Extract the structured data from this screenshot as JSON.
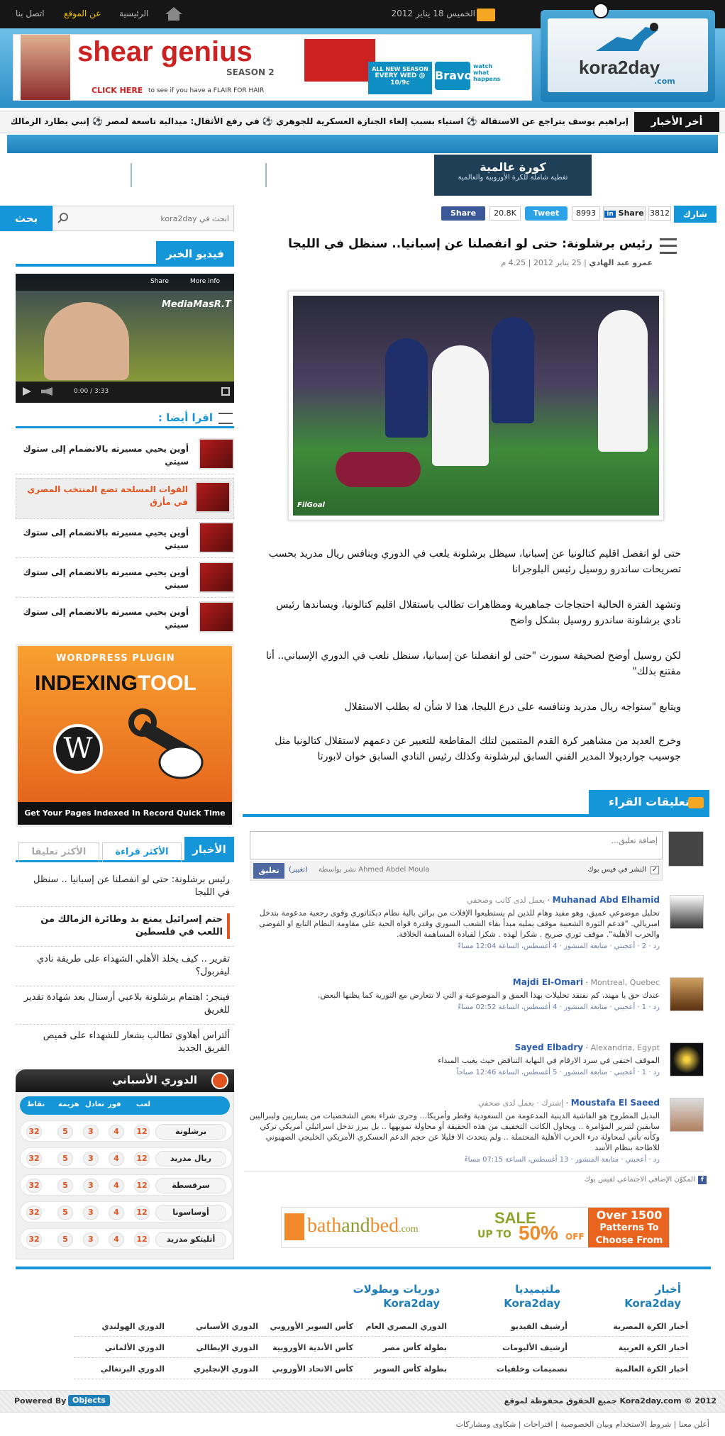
{
  "topbar": {
    "date": "الخميس 18 يناير 2012",
    "home": "الرئيسية",
    "about": "عن الموقع",
    "contact": "اتصل بنا"
  },
  "logo": {
    "name": "kora2day",
    "domain": ".com"
  },
  "banner": {
    "title": "shear genius",
    "season": "SEASON 2",
    "cta": "CLICK HERE",
    "cta_rest": "to see if you have a FLAIR FOR HAIR",
    "promo_line1": "ALL NEW SEASON",
    "promo_line2": "EVERY WED @ 10/9c",
    "brand": "Bravo",
    "slogan": "watch what happens"
  },
  "ticker": {
    "label": "أخر الأخبار",
    "items": [
      "إبراهيم يوسف يتراجع عن الاستقالة",
      "استياء بسبب إلغاء الجنازة العسكرية للجوهري",
      "في رفع الأثقال: ميدالية تاسعة لمصر",
      "إنبي يطارد الزمالك في"
    ]
  },
  "world": {
    "title": "كورة عالمية",
    "subtitle": "تغطية شاملة للكرة الأوروبية والعالمية"
  },
  "search": {
    "placeholder": "ابحث في kora2day",
    "button": "بحث"
  },
  "share": {
    "label": "شارك",
    "linkedin_count": "3812",
    "linkedin": "Share",
    "tweet_count": "8993",
    "tweet": "Tweet",
    "fb_count": "20.8K",
    "fb": "Share"
  },
  "video": {
    "title": "فيديو الخبر",
    "watermark": "MediaMasR.T",
    "share": "Share",
    "more": "More info",
    "time": "0:00 / 3:33"
  },
  "read_also": {
    "title": "اقرا أيضا :",
    "items": [
      "أوين يحيي مسيرته بالانضمام إلى ستوك سيتي",
      "القوات المسلحة تضع المنتخب المصري في مأزق",
      "أوين يحيي مسيرته بالانضمام إلى ستوك سيتي",
      "أوين يحيي مسيرته بالانضمام إلى ستوك سيتي",
      "أوين يحيي مسيرته بالانضمام إلى ستوك سيتي"
    ]
  },
  "ad_plugin": {
    "line1": "WORDPRESS PLUGIN",
    "line2a": "INDEXING",
    "line2b": "TOOL",
    "footer": "Get Your Pages Indexed In Record Quick Time"
  },
  "news_tabs": {
    "tabs": [
      "الأخبار",
      "الأكثر قراءة",
      "الأكثر تعليقا"
    ],
    "items": [
      "رئيس برشلونة: حتى لو انفصلنا عن إسبانيا .. سنظل في الليجا",
      "حتم إسرائيل يمنع بد وطائرة الزمالك من اللعب في فلسطين",
      "تقرير .. كيف يخلد الأهلي الشهداء على طريقة نادي ليفربول؟",
      "فينجر: اهتمام برشلونة بلاعبي أرسنال بعد شهادة تقدير للغريق",
      "ألتراس أهلاوي تطالب بشعار للشهداء على قميص الفريق الجديد"
    ]
  },
  "league": {
    "title": "الدوري الأسباني",
    "headers": [
      "لعب",
      "فوز",
      "تعادل",
      "هزيمة",
      "نقاط"
    ],
    "rows": [
      {
        "team": "برشلونة",
        "vals": [
          "12",
          "4",
          "3",
          "5",
          "32"
        ]
      },
      {
        "team": "ريال مدريد",
        "vals": [
          "12",
          "4",
          "3",
          "5",
          "32"
        ]
      },
      {
        "team": "سرقسطة",
        "vals": [
          "12",
          "4",
          "3",
          "5",
          "32"
        ]
      },
      {
        "team": "أوساسونا",
        "vals": [
          "12",
          "4",
          "3",
          "5",
          "32"
        ]
      },
      {
        "team": "أتليتكو مدريد",
        "vals": [
          "12",
          "4",
          "3",
          "5",
          "32"
        ]
      }
    ]
  },
  "article": {
    "title": "رئيس برشلونة: حتى لو انفصلنا عن إسبانيا.. سنظل في الليجا",
    "author": "عمرو عبد الهادي",
    "date": "25 يناير 2012",
    "time": "4.25 م",
    "photo_credit": "FilGoal",
    "paragraphs": [
      "حتى لو انفصل اقليم كتالونيا عن إسبانيا، سيظل برشلونة يلعب في الدوري وينافس ريال مدريد بحسب تصريحات ساندرو روسيل رئيس البلوجرانا",
      "وتشهد الفترة الحالية احتجاجات جماهيرية ومظاهرات تطالب باستقلال اقليم كتالونيا، ويساندها رئيس نادي برشلونة ساندرو روسيل بشكل واضح",
      "لكن روسيل أوضح لصحيفة سبورت \"حتى لو انفصلنا عن إسبانيا، سنظل نلعب في الدوري الإسباني.. أنا مقتنع بذلك\"",
      "ويتابع \"سنواجه ريال مدريد وننافسه على درع الليجا، هذا لا شأن له بطلب الاستقلال",
      "وخرج العديد من مشاهير كرة القدم المتنمين لتلك المقاطعة للتعبير عن دعمهم لاستقلال كتالونيا مثل جوسيب جوارديولا المدير الفني السابق لبرشلونة وكذلك رئيس النادي السابق خوان لابورتا"
    ]
  },
  "comments": {
    "title": "تعليقات القراء",
    "placeholder": "إضافة تعليق...",
    "fb_post": "النشر في فيس بوك",
    "posting_as": "نشر بواسطة Ahmed Abdel Moula",
    "change": "(تغيير)",
    "submit": "تعليق",
    "plugin": "المكوّن الإضافي الاجتماعي لفيس بوك",
    "items": [
      {
        "name": "Muhanad Abd Elhamid",
        "meta": "يعمل لدى كاتب وصحفي",
        "text": "تحليل موضوعي عميق، وهو مفيد وهام للذين لم يستطيعوا الإفلات من براثن بالية نظام ديكتاتوري وقوى رجعية مدعومة بتدخل امبريالي. \"فدعم الثورة الشعبية موقف يمليه مبدأ بقاء الشعب السوري وقدرة قواه الحية على مقاومة النظام التابع او الفوضى والحرب الأهلية\". موقف ثوري صريح . شكرا لهذه . شكرا لقيادة المساهمة الخلاقة.",
        "footer": "رد · 2 · أعجبني · متابعة المنشور · 4 أغسطس، الساعة 12:04 مساءً"
      },
      {
        "name": "Majdi El-Omari",
        "meta": "Montreal, Quebec",
        "text": "عندك حق يا مهند، كم نفتقد تحليلات بهذا العمق و الموضوعية و التي لا تتعارض مع الثورية كما يظنها البعض.",
        "footer": "رد · 1 · أعجبني · متابعة المنشور · 4 أغسطس، الساعة 02:52 مساءً"
      },
      {
        "name": "Sayed Elbadry",
        "meta": "Alexandria, Egypt",
        "text": "الموقف اختفى في سرد الارقام في النهاية التناقض حيث يغيب المبداء",
        "footer": "رد · 1 · أعجبني · متابعة المنشور · 5 أغسطس، الساعة 12:46 صباحاً"
      },
      {
        "name": "Moustafa El Saeed",
        "meta": "إشترك · يعمل لدى صحفي",
        "text": "البديل المطروح هو الفاشية الدينية المدعومة من السعودية وقطر وأمريكا... وجرى شراء بعض الشخصيات من يساريين وليبراليين سابقين لتبرير المؤامرة .. ويحاول الكاتب التخفيف من هذه الحقيقة أو محاولة تمويهها .. بل يبرز تدخل اسرائيلي أمريكي تركي وكأنه بأتي لمحاولة درء الحرب الأهلية المحتملة .. ولم يتحدث الا قليلا عن حجم الدعم العسكري الأمريكي الخليجي الصهيوني للاطاحة بنظام الأسد",
        "footer": "رد · أعجبني · متابعة المنشور · 13 أغسطس، الساعة 07:15 مساءً"
      }
    ]
  },
  "ad_bath": {
    "brand": "bath",
    "brand2": "and",
    "brand3": "bed",
    "tld": ".com",
    "sale": "SALE",
    "upto": "UP TO",
    "pct": "50%",
    "off": "OFF",
    "right1": "Over 1500",
    "right2": "Patterns To",
    "right3": "Choose From"
  },
  "footer": {
    "cols": [
      {
        "title": "أخبار",
        "sub": "Kora2day",
        "links": [
          "أخبار الكرة المصرية",
          "أخبار الكرة العربية",
          "أخبار الكرة العالمية"
        ]
      },
      {
        "title": "ملتيميديا",
        "sub": "Kora2day",
        "links": [
          "أرشيف الفيديو",
          "أرشيف الألبومات",
          "تصميمات وخلفيات"
        ]
      },
      {
        "title": "دوريات وبطولات",
        "sub": "Kora2day",
        "links": [
          "الدوري المصري العام",
          "كأس السوبر الأوروبي",
          "الدوري الأسباني",
          "الدوري الهولندي",
          "بطولة كأس مصر",
          "كأس الأندية الأوروبية",
          "الدوري الإيطالي",
          "الدوري الألماني",
          "بطولة كأس السوبر",
          "كأس الاتحاد الأوروبي",
          "الدوري الإنجليزي",
          "الدوري البرتغالي"
        ]
      }
    ],
    "copyright": "2012 © Kora2day.com جميع الحقوق محفوظة لموقع",
    "powered": "Powered By",
    "powered_brand": "Objects",
    "bottom_links": [
      "أعلن معنا",
      "شروط الاستخدام وبيان الخصوصية",
      "اقتراحات",
      "شكاوى ومشاركات"
    ]
  }
}
